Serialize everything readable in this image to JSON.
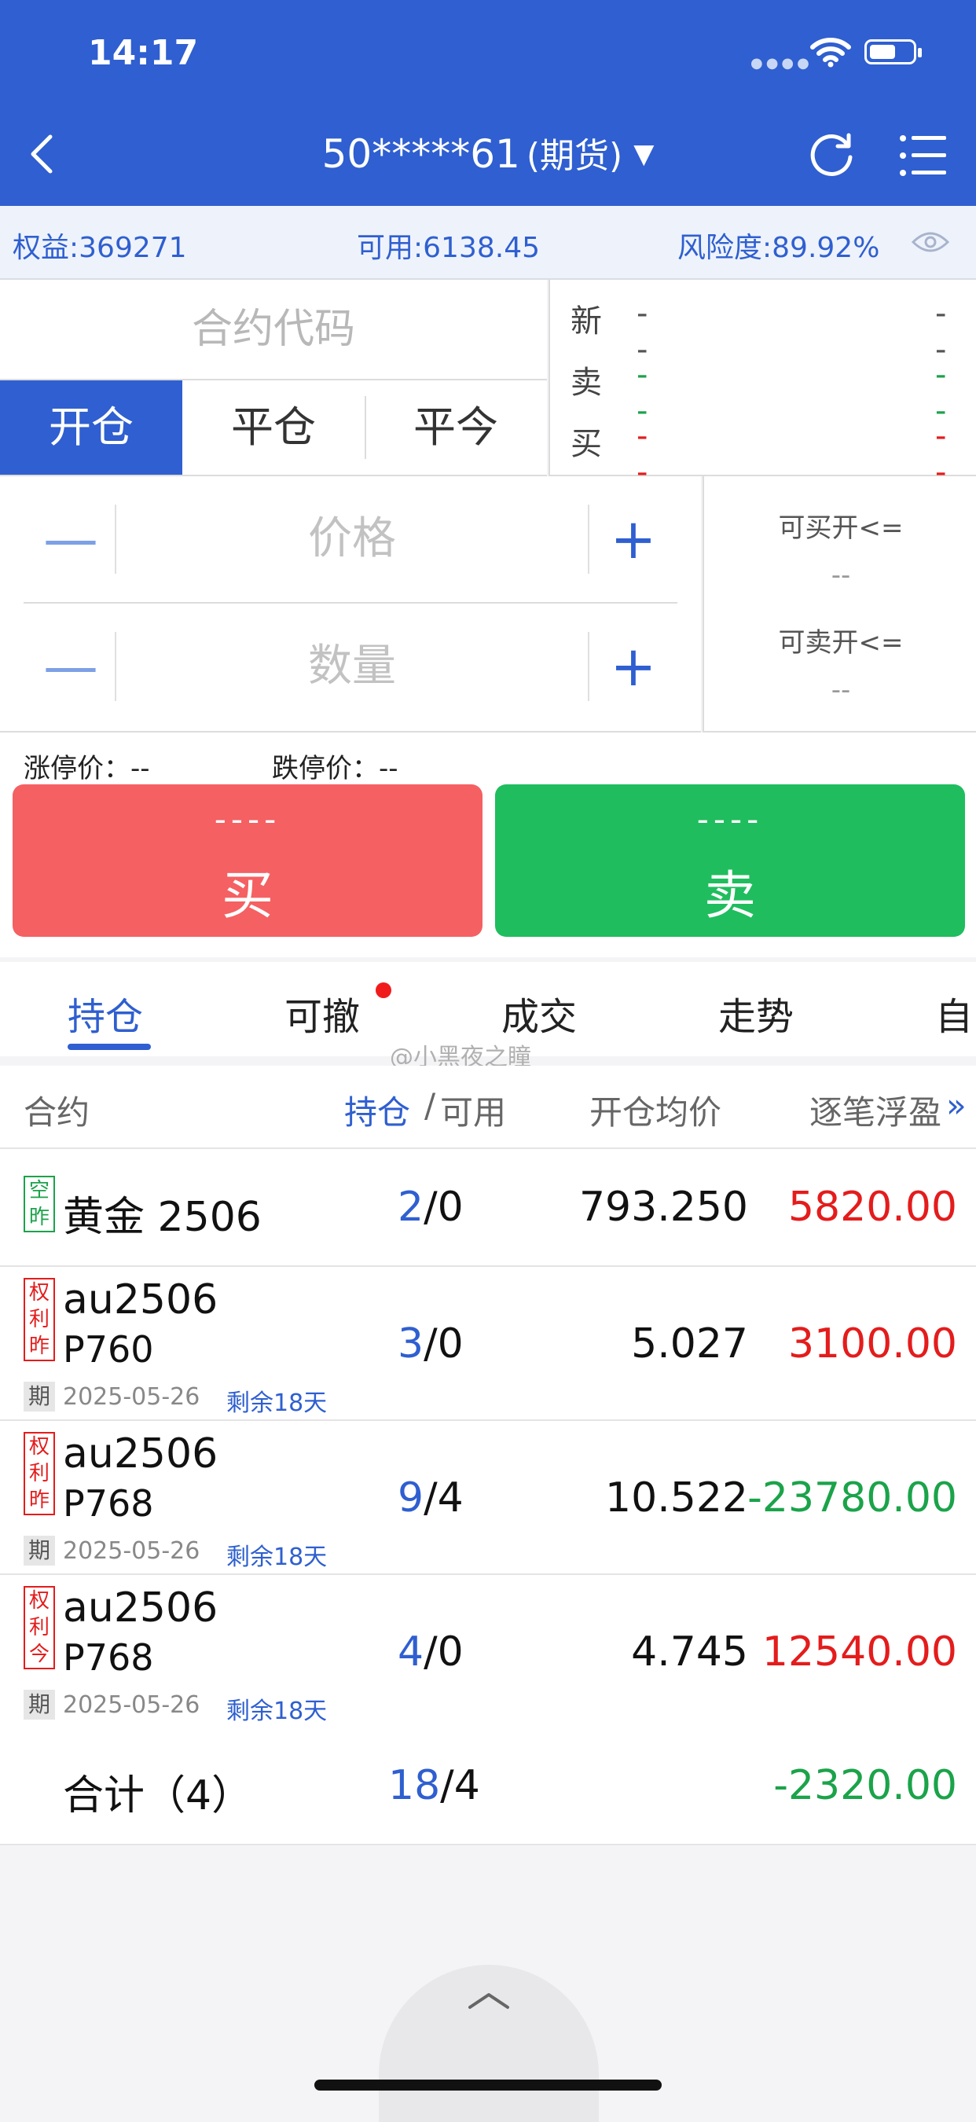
{
  "status_bar": {
    "time": "14:17"
  },
  "header": {
    "account": "50*****61",
    "account_type": "(期货)"
  },
  "info": {
    "equity": "权益:369271",
    "available": "可用:6138.45",
    "risk": "风险度:89.92%"
  },
  "order": {
    "contract_placeholder": "合约代码",
    "tabs": [
      "开仓",
      "平仓",
      "平今"
    ],
    "quote": [
      {
        "label": "新",
        "left": "--",
        "right": "--"
      },
      {
        "label": "卖",
        "left": "--",
        "right": "--"
      },
      {
        "label": "买",
        "left": "--",
        "right": "--"
      }
    ],
    "price_placeholder": "价格",
    "qty_placeholder": "数量",
    "can_buy_label": "可买开<=",
    "can_buy_value": "--",
    "can_sell_label": "可卖开<=",
    "can_sell_value": "--",
    "limit_up": "涨停价：--",
    "limit_down": "跌停价：--",
    "buy_price": "----",
    "buy_label": "买",
    "sell_price": "----",
    "sell_label": "卖"
  },
  "bottom_tabs": [
    "持仓",
    "可撤",
    "成交",
    "走势",
    "自"
  ],
  "watermark": "@小黑夜之瞳",
  "table": {
    "headers": {
      "contract": "合约",
      "pos": "持仓",
      "slash": "/",
      "avail": "可用",
      "avg": "开仓均价",
      "pnl": "逐笔浮盈"
    },
    "rows": [
      {
        "tags": [
          "空",
          "昨"
        ],
        "name": "黄金 2506",
        "pos": "2",
        "avail": "/0",
        "avg": "793.250",
        "pnl": "5820.00"
      },
      {
        "tags": [
          "权",
          "利",
          "昨"
        ],
        "name": "au2506",
        "name2": "P760",
        "expire_tag": "期",
        "expire": "2025-05-26",
        "remain": "剩余18天",
        "pos": "3",
        "avail": "/0",
        "avg": "5.027",
        "pnl": "3100.00"
      },
      {
        "tags": [
          "权",
          "利",
          "昨"
        ],
        "name": "au2506",
        "name2": "P768",
        "expire_tag": "期",
        "expire": "2025-05-26",
        "remain": "剩余18天",
        "pos": "9",
        "avail": "/4",
        "avg": "10.522",
        "pnl": "-23780.00"
      },
      {
        "tags": [
          "权",
          "利",
          "今"
        ],
        "name": "au2506",
        "name2": "P768",
        "expire_tag": "期",
        "expire": "2025-05-26",
        "remain": "剩余18天",
        "pos": "4",
        "avail": "/0",
        "avg": "4.745",
        "pnl": "12540.00"
      }
    ],
    "total": {
      "label": "合计（4）",
      "pos": "18",
      "avail": "/4",
      "pnl": "-2320.00"
    }
  },
  "colors": {
    "primary": "#2f5fd0",
    "buy": "#f56062",
    "sell": "#1fbd5e",
    "profit": "#e41c1c",
    "loss": "#1ba34a"
  },
  "icons": [
    "back-icon",
    "caret-down-icon",
    "refresh-icon",
    "menu-icon",
    "eye-icon",
    "minus-icon",
    "plus-icon",
    "chevron-right-icon",
    "chevron-up-icon",
    "wifi-icon",
    "battery-icon"
  ]
}
